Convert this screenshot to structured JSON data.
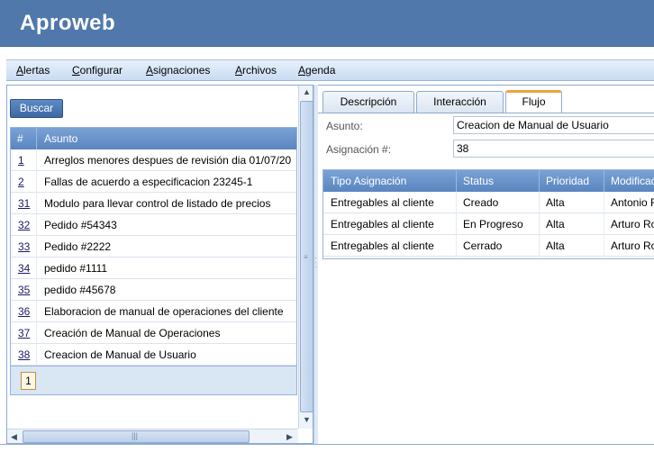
{
  "app": {
    "title": "Aproweb"
  },
  "menu": [
    {
      "label": "Alertas",
      "underline": "A",
      "rest": "lertas"
    },
    {
      "label": "Configurar",
      "underline": "C",
      "rest": "onfigurar"
    },
    {
      "label": "Asignaciones",
      "underline": "A",
      "rest": "signaciones"
    },
    {
      "label": "Archivos",
      "underline": "A",
      "rest": "rchivos"
    },
    {
      "label": "Agenda",
      "underline": "A",
      "rest": "genda"
    }
  ],
  "left": {
    "search_button": "Buscar",
    "columns": [
      "#",
      "Asunto"
    ],
    "rows": [
      {
        "num": "1",
        "asunto": "Arreglos menores despues de revisión dia 01/07/20"
      },
      {
        "num": "2",
        "asunto": "Fallas de acuerdo a especificacion 23245-1"
      },
      {
        "num": "31",
        "asunto": "Modulo para llevar control de listado de precios"
      },
      {
        "num": "32",
        "asunto": "Pedido #54343"
      },
      {
        "num": "33",
        "asunto": "Pedido #2222"
      },
      {
        "num": "34",
        "asunto": "pedido #1111"
      },
      {
        "num": "35",
        "asunto": "pedido #45678"
      },
      {
        "num": "36",
        "asunto": "Elaboracion de manual de operaciones del cliente"
      },
      {
        "num": "37",
        "asunto": "Creación de Manual de Operaciones"
      },
      {
        "num": "38",
        "asunto": "Creacion de Manual de Usuario"
      }
    ],
    "pager": {
      "current_page": "1"
    }
  },
  "right": {
    "tabs": [
      {
        "label": "Descripción",
        "active": false
      },
      {
        "label": "Interacción",
        "active": false
      },
      {
        "label": "Flujo",
        "active": true
      }
    ],
    "fields": {
      "asunto_label": "Asunto:",
      "asunto_value": "Creacion de Manual de Usuario",
      "asignacion_label": "Asignación #:",
      "asignacion_value": "38"
    },
    "columns": [
      "Tipo Asignación",
      "Status",
      "Prioridad",
      "Modificado"
    ],
    "rows": [
      {
        "tipo": "Entregables al cliente",
        "status": "Creado",
        "prioridad": "Alta",
        "modificado": "Antonio R"
      },
      {
        "tipo": "Entregables al cliente",
        "status": "En Progreso",
        "prioridad": "Alta",
        "modificado": "Arturo Ro"
      },
      {
        "tipo": "Entregables al cliente",
        "status": "Cerrado",
        "prioridad": "Alta",
        "modificado": "Arturo Ro"
      }
    ]
  },
  "colors": {
    "header": "#5078ab",
    "grid_header": "#6a93c9",
    "active_tab_accent": "#f0a43c"
  }
}
